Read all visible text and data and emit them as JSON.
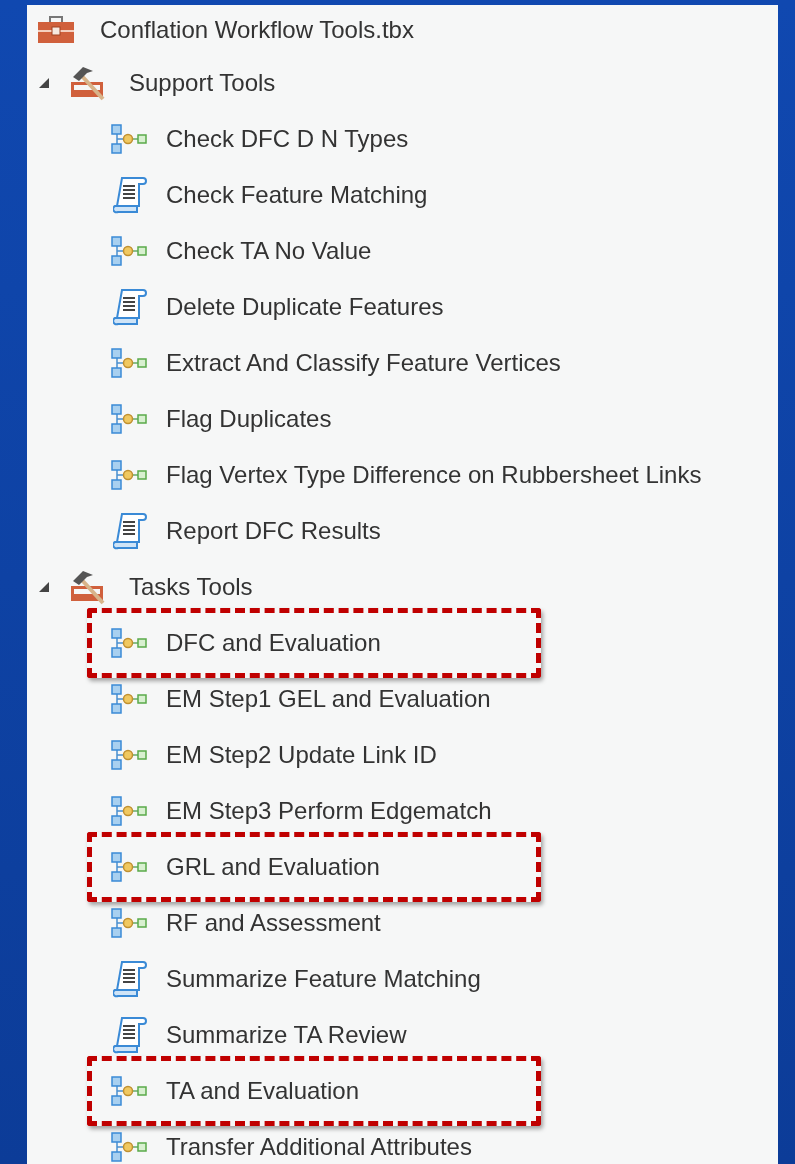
{
  "toolbox": {
    "name": "Conflation Workflow Tools.tbx",
    "children": [
      {
        "name": "Support Tools",
        "expanded": true,
        "children": [
          {
            "name": "Check DFC D N Types",
            "kind": "model",
            "highlighted": false
          },
          {
            "name": "Check Feature Matching",
            "kind": "script",
            "highlighted": false
          },
          {
            "name": "Check TA No Value",
            "kind": "model",
            "highlighted": false
          },
          {
            "name": "Delete Duplicate Features",
            "kind": "script",
            "highlighted": false
          },
          {
            "name": "Extract And Classify Feature Vertices",
            "kind": "model",
            "highlighted": false
          },
          {
            "name": "Flag Duplicates",
            "kind": "model",
            "highlighted": false
          },
          {
            "name": "Flag Vertex Type Difference on Rubbersheet Links",
            "kind": "model",
            "highlighted": false
          },
          {
            "name": "Report DFC Results",
            "kind": "script",
            "highlighted": false
          }
        ]
      },
      {
        "name": "Tasks Tools",
        "expanded": true,
        "children": [
          {
            "name": "DFC and Evaluation",
            "kind": "model",
            "highlighted": true
          },
          {
            "name": "EM Step1 GEL and Evaluation",
            "kind": "model",
            "highlighted": false
          },
          {
            "name": "EM Step2 Update Link ID",
            "kind": "model",
            "highlighted": false
          },
          {
            "name": "EM Step3 Perform Edgematch",
            "kind": "model",
            "highlighted": false
          },
          {
            "name": "GRL and Evaluation",
            "kind": "model",
            "highlighted": true
          },
          {
            "name": "RF and Assessment",
            "kind": "model",
            "highlighted": false
          },
          {
            "name": "Summarize Feature Matching",
            "kind": "script",
            "highlighted": false
          },
          {
            "name": "Summarize TA Review",
            "kind": "script",
            "highlighted": false
          },
          {
            "name": "TA and Evaluation",
            "kind": "model",
            "highlighted": true
          },
          {
            "name": "Transfer Additional Attributes",
            "kind": "model",
            "highlighted": false
          }
        ]
      }
    ]
  }
}
